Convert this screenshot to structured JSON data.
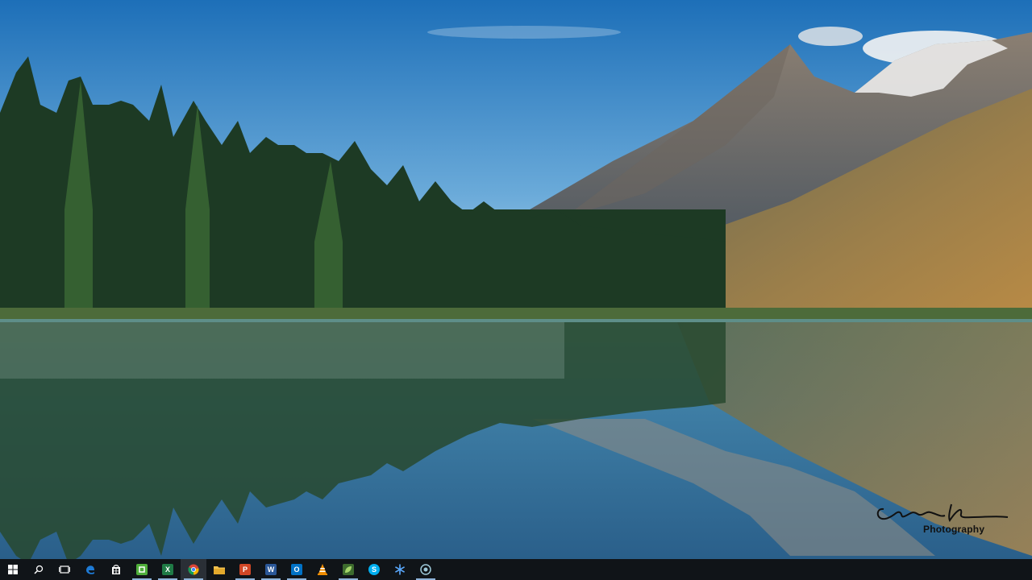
{
  "wallpaper": {
    "name": "mountain-lake-wallpaper",
    "watermark_text": "Photography",
    "colors": {
      "sky_top": "#1d6fb8",
      "sky_bottom": "#b9d8ee",
      "forest": "#1d3a24",
      "hillside": "#9c7f4a",
      "water": "#3f7fa6"
    }
  },
  "taskbar": {
    "background": "#101418",
    "items": [
      {
        "name": "start-button",
        "icon": "windows-icon",
        "color": "#ffffff",
        "running": false
      },
      {
        "name": "search-button",
        "icon": "search-icon",
        "color": "#ffffff",
        "running": false
      },
      {
        "name": "task-view-button",
        "icon": "task-view-icon",
        "color": "#ffffff",
        "running": false
      },
      {
        "name": "taskbar-edge",
        "icon": "edge-icon",
        "color": "#1e7bd6",
        "running": false
      },
      {
        "name": "taskbar-store",
        "icon": "store-icon",
        "color": "#ffffff",
        "running": false
      },
      {
        "name": "taskbar-camtasia",
        "icon": "camtasia-icon",
        "color": "#4fae3a",
        "running": true
      },
      {
        "name": "taskbar-excel",
        "icon": "excel-icon",
        "color": "#1f7a45",
        "running": true
      },
      {
        "name": "taskbar-chrome",
        "icon": "chrome-icon",
        "color": "#db4437",
        "running": true,
        "active": true
      },
      {
        "name": "taskbar-file-explorer",
        "icon": "folder-icon",
        "color": "#f2c14e",
        "running": false
      },
      {
        "name": "taskbar-powerpoint",
        "icon": "powerpoint-icon",
        "color": "#d24726",
        "running": true
      },
      {
        "name": "taskbar-word",
        "icon": "word-icon",
        "color": "#2b5797",
        "running": true
      },
      {
        "name": "taskbar-outlook",
        "icon": "outlook-icon",
        "color": "#0072c6",
        "running": true
      },
      {
        "name": "taskbar-vlc",
        "icon": "vlc-icon",
        "color": "#f08c00",
        "running": false
      },
      {
        "name": "taskbar-photo-app",
        "icon": "leaf-icon",
        "color": "#6aa84f",
        "running": true
      },
      {
        "name": "taskbar-skype",
        "icon": "skype-icon",
        "color": "#00aff0",
        "running": false
      },
      {
        "name": "taskbar-snowflake-app",
        "icon": "snowflake-icon",
        "color": "#5aa9ff",
        "running": false
      },
      {
        "name": "taskbar-camera-app",
        "icon": "camera-icon",
        "color": "#9ec9d9",
        "running": true
      }
    ]
  }
}
